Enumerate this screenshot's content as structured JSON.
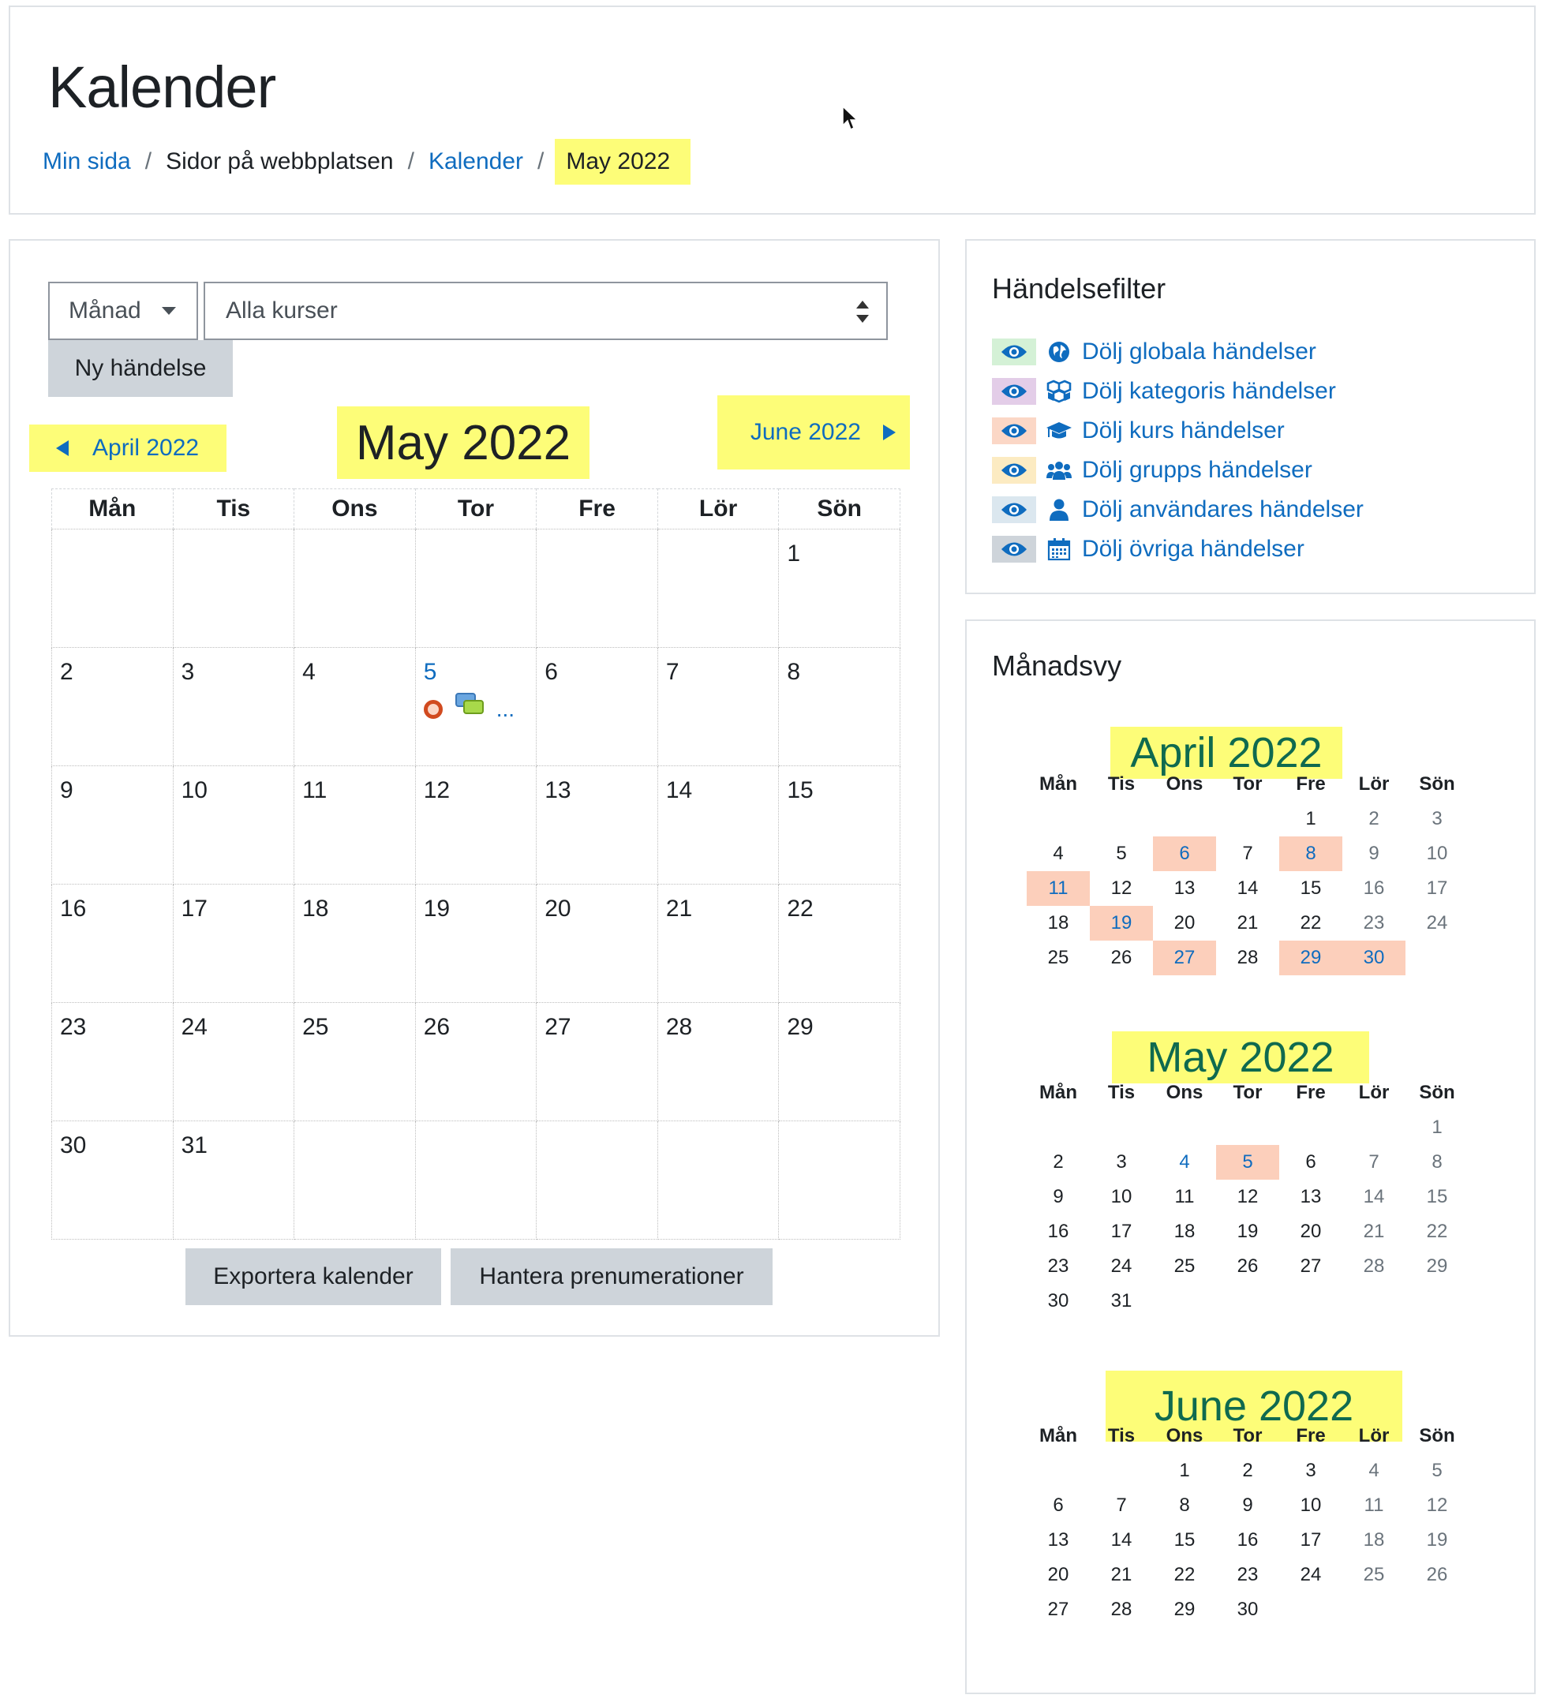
{
  "header": {
    "title": "Kalender",
    "breadcrumb": [
      {
        "label": "Min sida",
        "link": true
      },
      {
        "label": "Sidor på webbplatsen",
        "link": false
      },
      {
        "label": "Kalender",
        "link": true
      },
      {
        "label": "May 2022",
        "link": false,
        "current": true
      }
    ]
  },
  "controls": {
    "view_select": "Månad",
    "course_select": "Alla kurser",
    "new_event": "Ny händelse"
  },
  "nav": {
    "prev": "April 2022",
    "current": "May 2022",
    "next": "June 2022"
  },
  "month": {
    "weekdays": [
      "Mån",
      "Tis",
      "Ons",
      "Tor",
      "Fre",
      "Lör",
      "Sön"
    ],
    "weeks": [
      [
        "",
        "",
        "",
        "",
        "",
        "",
        "1"
      ],
      [
        "2",
        "3",
        "4",
        "5",
        "6",
        "7",
        "8"
      ],
      [
        "9",
        "10",
        "11",
        "12",
        "13",
        "14",
        "15"
      ],
      [
        "16",
        "17",
        "18",
        "19",
        "20",
        "21",
        "22"
      ],
      [
        "23",
        "24",
        "25",
        "26",
        "27",
        "28",
        "29"
      ],
      [
        "30",
        "31",
        "",
        "",
        "",
        "",
        ""
      ]
    ],
    "event_day": "5",
    "more_label": "..."
  },
  "footer_buttons": {
    "export": "Exportera kalender",
    "subscriptions": "Hantera prenumerationer"
  },
  "filter": {
    "title": "Händelsefilter",
    "items": [
      {
        "label": "Dölj globala händelser",
        "icon": "globe-icon",
        "swatch": "#d4f1d6"
      },
      {
        "label": "Dölj kategoris händelser",
        "icon": "cubes-icon",
        "swatch": "#e3cde8"
      },
      {
        "label": "Dölj kurs händelser",
        "icon": "graduation-cap-icon",
        "swatch": "#fbd7c6"
      },
      {
        "label": "Dölj grupps händelser",
        "icon": "users-icon",
        "swatch": "#fcebc2"
      },
      {
        "label": "Dölj användares händelser",
        "icon": "user-icon",
        "swatch": "#dbe7ef"
      },
      {
        "label": "Dölj övriga händelser",
        "icon": "calendar-icon",
        "swatch": "#ced4da"
      }
    ]
  },
  "mini": {
    "title": "Månadsvy",
    "weekdays": [
      "Mån",
      "Tis",
      "Ons",
      "Tor",
      "Fre",
      "Lör",
      "Sön"
    ],
    "months": [
      {
        "name": "April 2022",
        "weeks": [
          [
            "",
            "",
            "",
            "",
            "1",
            "2",
            "3"
          ],
          [
            "4",
            "5",
            "6",
            "7",
            "8",
            "9",
            "10"
          ],
          [
            "11",
            "12",
            "13",
            "14",
            "15",
            "16",
            "17"
          ],
          [
            "18",
            "19",
            "20",
            "21",
            "22",
            "23",
            "24"
          ],
          [
            "25",
            "26",
            "27",
            "28",
            "29",
            "30",
            ""
          ]
        ],
        "event_days": [
          "6",
          "8",
          "11",
          "19",
          "27",
          "29",
          "30"
        ],
        "linked_days": []
      },
      {
        "name": "May 2022",
        "weeks": [
          [
            "",
            "",
            "",
            "",
            "",
            "",
            "1"
          ],
          [
            "2",
            "3",
            "4",
            "5",
            "6",
            "7",
            "8"
          ],
          [
            "9",
            "10",
            "11",
            "12",
            "13",
            "14",
            "15"
          ],
          [
            "16",
            "17",
            "18",
            "19",
            "20",
            "21",
            "22"
          ],
          [
            "23",
            "24",
            "25",
            "26",
            "27",
            "28",
            "29"
          ],
          [
            "30",
            "31",
            "",
            "",
            "",
            "",
            ""
          ]
        ],
        "event_days": [
          "5"
        ],
        "linked_days": [
          "4"
        ]
      },
      {
        "name": "June 2022",
        "weeks": [
          [
            "",
            "",
            "1",
            "2",
            "3",
            "4",
            "5"
          ],
          [
            "6",
            "7",
            "8",
            "9",
            "10",
            "11",
            "12"
          ],
          [
            "13",
            "14",
            "15",
            "16",
            "17",
            "18",
            "19"
          ],
          [
            "20",
            "21",
            "22",
            "23",
            "24",
            "25",
            "26"
          ],
          [
            "27",
            "28",
            "29",
            "30",
            "",
            "",
            ""
          ]
        ],
        "event_days": [],
        "linked_days": []
      }
    ]
  },
  "colors": {
    "link": "#0f6cbf",
    "highlight": "#fdfd78",
    "event_bg": "#fccfbb",
    "mini_title": "#0f6a4f"
  }
}
